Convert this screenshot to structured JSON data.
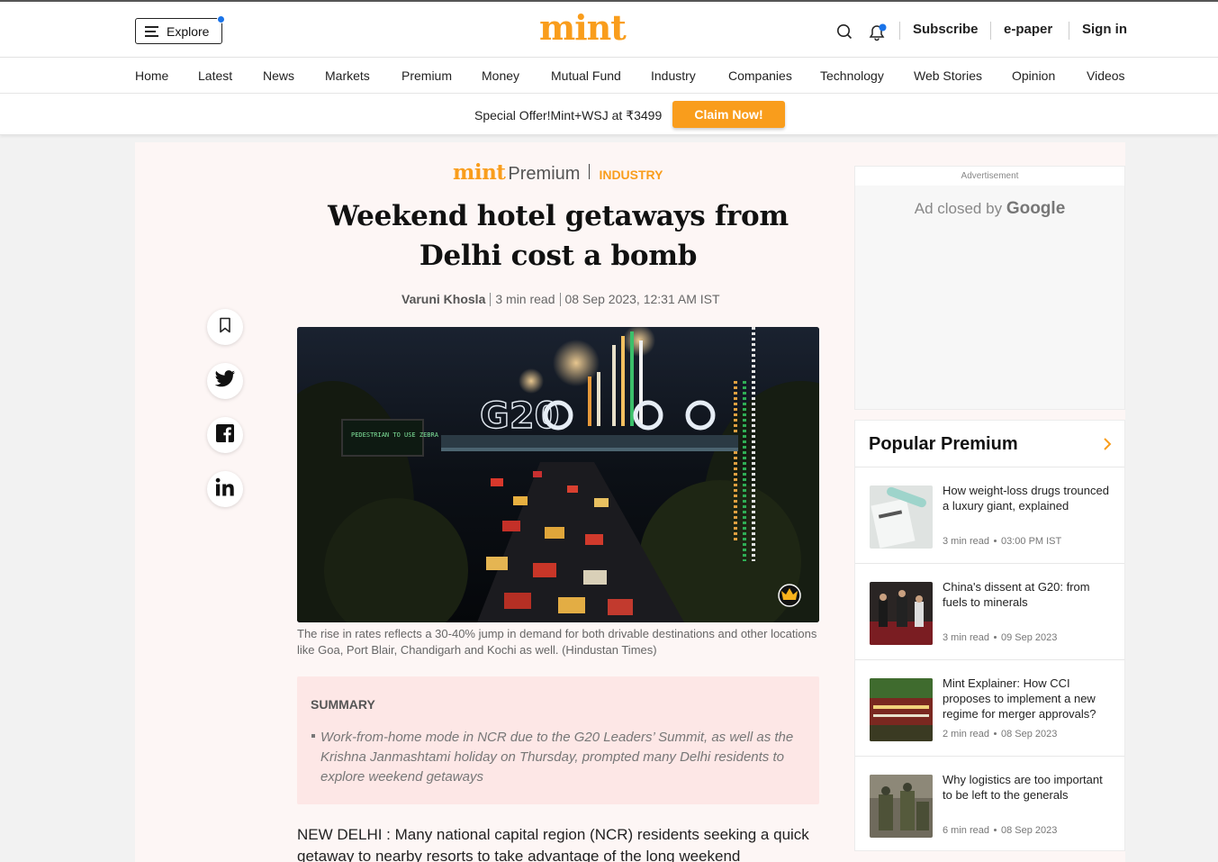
{
  "header": {
    "explore_label": "Explore",
    "logo": "mint",
    "subscribe": "Subscribe",
    "epaper": "e-paper",
    "signin": "Sign in"
  },
  "nav": {
    "items": [
      "Home",
      "Latest",
      "News",
      "Markets",
      "Premium",
      "Money",
      "Mutual Fund",
      "Industry",
      "Companies",
      "Technology",
      "Web Stories",
      "Opinion",
      "Videos"
    ]
  },
  "offer": {
    "text": "Special Offer!Mint+WSJ at ₹3499",
    "button": "Claim Now!"
  },
  "article": {
    "brand": "mint",
    "brand_premium": "Premium",
    "section": "INDUSTRY",
    "title": "Weekend hotel getaways from Delhi cost a bomb",
    "author": "Varuni Khosla",
    "read_time": "3 min read",
    "date": "08 Sep 2023, 12:31 AM IST",
    "photo_sign_text": "PEDESTRIAN TO USE ZEBRA",
    "photo_g20_text": "G20",
    "caption": "The rise in rates reflects a 30-40% jump in demand for both drivable destinations and other locations like Goa, Port Blair, Chandigarh and Kochi as well. (Hindustan Times)",
    "summary_heading": "SUMMARY",
    "summary_text": "Work-from-home mode in NCR due to the G20 Leaders’ Summit, as well as the Krishna Janmashtami holiday on Thursday, prompted many Delhi residents to explore weekend getaways",
    "body": "NEW DELHI : Many national capital region (NCR) residents seeking a quick getaway to nearby resorts to take advantage of the long weekend"
  },
  "ad": {
    "label": "Advertisement",
    "closed_prefix": "Ad closed by",
    "closed_brand": "Google"
  },
  "popular": {
    "heading": "Popular Premium",
    "items": [
      {
        "title": "How weight-loss drugs trounced a luxury giant, explained",
        "read": "3 min read",
        "time": "03:00 PM IST"
      },
      {
        "title": "China's dissent at G20: from fuels to minerals",
        "read": "3 min read",
        "time": "09 Sep 2023"
      },
      {
        "title": "Mint Explainer: How CCI proposes to implement a new regime for merger approvals?",
        "read": "2 min read",
        "time": "08 Sep 2023"
      },
      {
        "title": "Why logistics are too important to be left to the generals",
        "read": "6 min read",
        "time": "08 Sep 2023"
      }
    ]
  },
  "colors": {
    "brand_orange": "#f99d1c",
    "notification_blue": "#1a73e8",
    "summary_bg": "#fde7e6"
  }
}
